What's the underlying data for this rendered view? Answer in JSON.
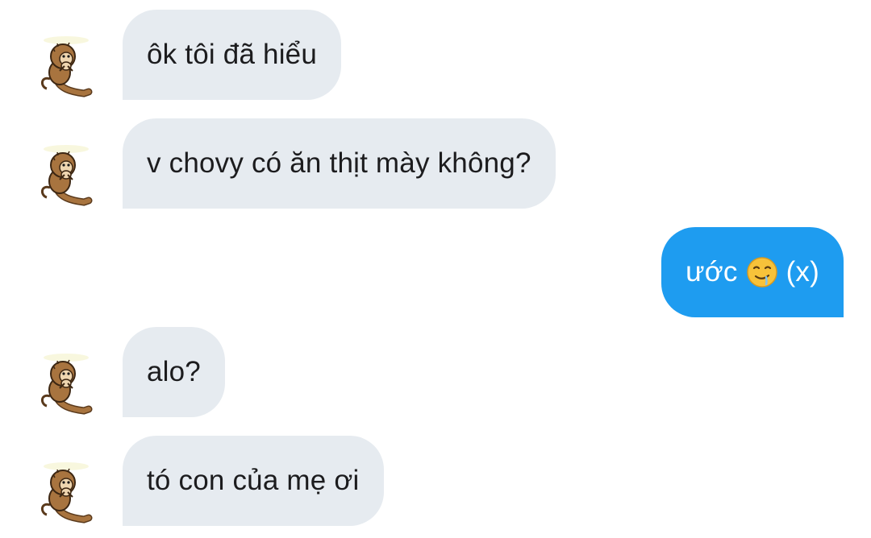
{
  "messages": [
    {
      "direction": "in",
      "text": "ôk tôi đã hiểu"
    },
    {
      "direction": "in",
      "text": "v chovy có ăn thịt mày không?"
    },
    {
      "direction": "out",
      "text_before": "ước",
      "emoji": "drooling-face-emoji",
      "text_after": "(x)"
    },
    {
      "direction": "in",
      "text": "alo?"
    },
    {
      "direction": "in",
      "text": "tó con của mẹ ơi"
    }
  ],
  "avatar": {
    "icon": "sitting-monkey-avatar-icon"
  },
  "colors": {
    "incoming_bubble": "#e6ebf0",
    "outgoing_bubble": "#1e9cf0",
    "incoming_text": "#1c1c1e",
    "outgoing_text": "#ffffff"
  }
}
